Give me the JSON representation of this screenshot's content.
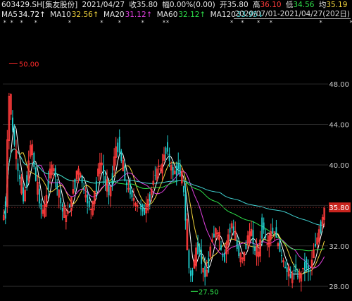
{
  "header": {
    "stock": "603429.SH[集友股份]",
    "date": "2021/04/27",
    "close_label": "收",
    "close": "35.80",
    "change_label": "幅",
    "change": "0.00%(0.00)",
    "open_label": "开",
    "open": "35.80",
    "high_label": "高",
    "high": "36.10",
    "low_label": "低",
    "low": "34.56",
    "avg_label": "均",
    "avg": "35.19"
  },
  "ma_bar": [
    {
      "label": "MA5",
      "value": "34.72↑",
      "color": "#ffffff"
    },
    {
      "label": "MA10",
      "value": "32.56↑",
      "color": "#f2d43c"
    },
    {
      "label": "MA20",
      "value": "31.12↑",
      "color": "#e040e0"
    },
    {
      "label": "MA60",
      "value": "32.12↑",
      "color": "#2ee04a"
    },
    {
      "label": "MA120",
      "value": "33.95↓",
      "color": "#40d0d0"
    }
  ],
  "date_range": "2020/07/01-2021/04/27(202日)",
  "colors": {
    "up": "#ff3b3b",
    "down": "#20d0d0",
    "bg": "#000000",
    "grid": "#2a2a2a",
    "price_marker": "#ff2a2a",
    "current_tag": "#c8241e"
  },
  "chart_data": {
    "type": "candlestick",
    "ylim": [
      27,
      51
    ],
    "y_ticks": [
      "48.00",
      "44.00",
      "40.00",
      "36.00",
      "32.00",
      "28.00"
    ],
    "y_tick_values": [
      48,
      44,
      40,
      36,
      32,
      28
    ],
    "current_price_tag": "35.80",
    "current_price": 35.8,
    "annotations": [
      {
        "text": "50.00",
        "value": 50.0
      },
      {
        "text": "27.50",
        "value": 27.5
      }
    ],
    "closes": [
      35.0,
      36.4,
      42.5,
      46.8,
      45.0,
      43.4,
      42.0,
      40.6,
      39.4,
      38.6,
      37.2,
      36.4,
      37.5,
      39.0,
      40.4,
      41.9,
      41.0,
      39.8,
      38.4,
      37.1,
      36.2,
      35.6,
      35.2,
      36.1,
      37.0,
      38.4,
      39.6,
      40.0,
      39.4,
      38.8,
      37.6,
      36.8,
      36.2,
      35.4,
      34.8,
      35.0,
      35.4,
      36.0,
      36.8,
      37.6,
      38.6,
      39.4,
      39.6,
      38.8,
      38.2,
      37.6,
      36.8,
      36.2,
      35.8,
      35.6,
      36.4,
      37.4,
      38.4,
      39.6,
      40.2,
      40.0,
      39.0,
      38.2,
      37.4,
      37.0,
      37.8,
      39.2,
      40.8,
      41.8,
      42.2,
      41.2,
      40.4,
      39.4,
      38.4,
      38.0,
      37.6,
      37.1,
      36.8,
      36.5,
      36.2,
      36.0,
      35.8,
      35.6,
      35.4,
      35.7,
      36.1,
      36.6,
      37.1,
      37.6,
      38.4,
      39.0,
      39.6,
      39.9,
      39.6,
      40.1,
      41.0,
      41.7,
      41.3,
      40.4,
      39.5,
      39.0,
      39.4,
      39.9,
      39.6,
      38.9,
      38.2,
      37.3,
      34.5,
      31.6,
      29.8,
      29.0,
      29.6,
      30.6,
      31.8,
      32.4,
      31.4,
      30.2,
      29.4,
      28.9,
      29.6,
      30.8,
      31.9,
      32.6,
      33.2,
      33.7,
      33.3,
      32.6,
      31.6,
      30.9,
      31.3,
      32.2,
      33.1,
      33.8,
      34.2,
      33.5,
      32.6,
      31.7,
      31.0,
      30.4,
      30.8,
      31.4,
      32.2,
      33.0,
      33.4,
      33.0,
      32.2,
      31.5,
      31.0,
      31.4,
      32.6,
      34.8,
      33.6,
      32.8,
      32.2,
      33.0,
      33.4,
      33.8,
      33.4,
      32.8,
      32.0,
      31.4,
      31.0,
      30.4,
      29.8,
      29.4,
      29.0,
      28.8,
      29.2,
      29.6,
      29.4,
      29.0,
      28.8,
      29.2,
      29.8,
      30.4,
      29.8,
      29.4,
      29.6,
      30.6,
      31.6,
      32.2,
      32.8,
      33.6,
      34.4,
      34.8,
      35.8
    ]
  }
}
